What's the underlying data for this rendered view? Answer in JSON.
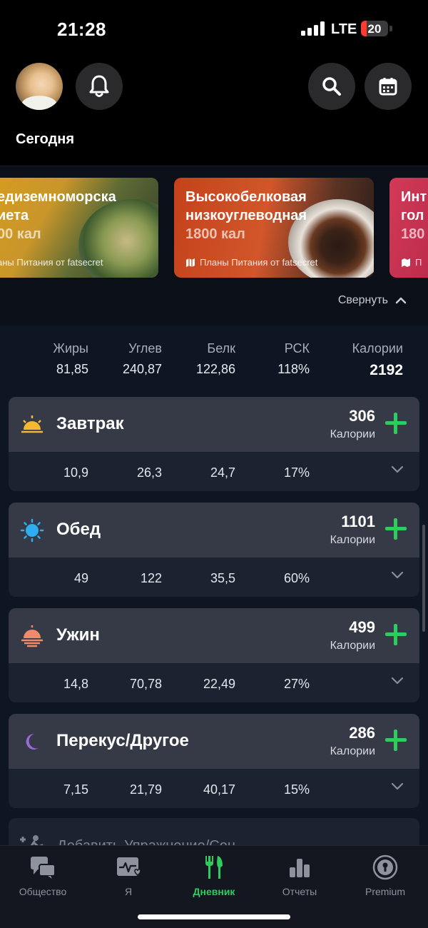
{
  "status_bar": {
    "time": "21:28",
    "network": "LTE",
    "battery": "20",
    "battery_level": 0.2
  },
  "header": {
    "title": "Сегодня"
  },
  "plans": [
    {
      "title_line1": "едиземноморска",
      "title_line2": "иета",
      "calories": "00 кал",
      "source": "аны Питания от fatsecret"
    },
    {
      "title_line1": "Высокобелковая",
      "title_line2": "низкоуглеводная",
      "calories": "1800 кал",
      "source": "Планы Питания от fatsecret"
    },
    {
      "title_line1": "Инт",
      "title_line2": "гол",
      "calories": "180",
      "source": "П"
    }
  ],
  "collapse_label": "Свернуть",
  "totals": {
    "labels": [
      "Жиры",
      "Углев",
      "Белк",
      "РСК",
      "Калории"
    ],
    "values": [
      "81,85",
      "240,87",
      "122,86",
      "118%",
      "2192"
    ]
  },
  "meals": [
    {
      "name": "Завтрак",
      "calories": "306",
      "calories_label": "Калории",
      "values": [
        "10,9",
        "26,3",
        "24,7",
        "17%"
      ]
    },
    {
      "name": "Обед",
      "calories": "1101",
      "calories_label": "Калории",
      "values": [
        "49",
        "122",
        "35,5",
        "60%"
      ]
    },
    {
      "name": "Ужин",
      "calories": "499",
      "calories_label": "Калории",
      "values": [
        "14,8",
        "70,78",
        "22,49",
        "27%"
      ]
    },
    {
      "name": "Перекус/Другое",
      "calories": "286",
      "calories_label": "Калории",
      "values": [
        "7,15",
        "21,79",
        "40,17",
        "15%"
      ]
    }
  ],
  "exercise": {
    "label": "Добавить Упражнение/Сон"
  },
  "tabs": [
    {
      "label": "Общество",
      "icon": "community-icon"
    },
    {
      "label": "Я",
      "icon": "me-icon"
    },
    {
      "label": "Дневник",
      "icon": "diary-icon",
      "active": true
    },
    {
      "label": "Отчеты",
      "icon": "reports-icon"
    },
    {
      "label": "Premium",
      "icon": "premium-icon"
    }
  ],
  "colors": {
    "accent": "#2ecc5f",
    "background": "#000000",
    "card": "#353a46",
    "battery_low": "#ff3b30"
  }
}
